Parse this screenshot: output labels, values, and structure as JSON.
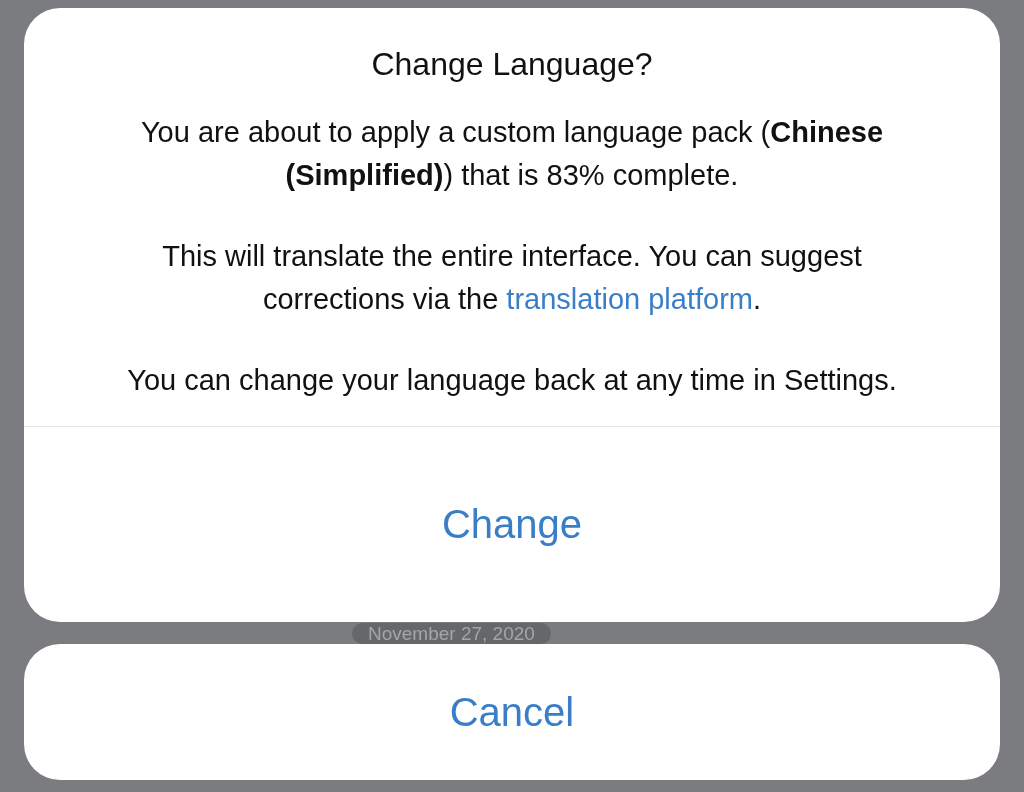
{
  "background": {
    "date_badge": "November 27, 2020"
  },
  "alert": {
    "title": "Change Language?",
    "paragraphs": [
      {
        "text": "You are about to apply a custom language pack (**Chinese (Simplified)**) that is 83% complete."
      },
      {
        "text": "This will translate the entire interface. You can suggest corrections via the ",
        "link": "translation platform",
        "after": "."
      },
      {
        "text": "You can change your language back at any time in Settings."
      }
    ],
    "action": "Change"
  },
  "cancel": "Cancel"
}
